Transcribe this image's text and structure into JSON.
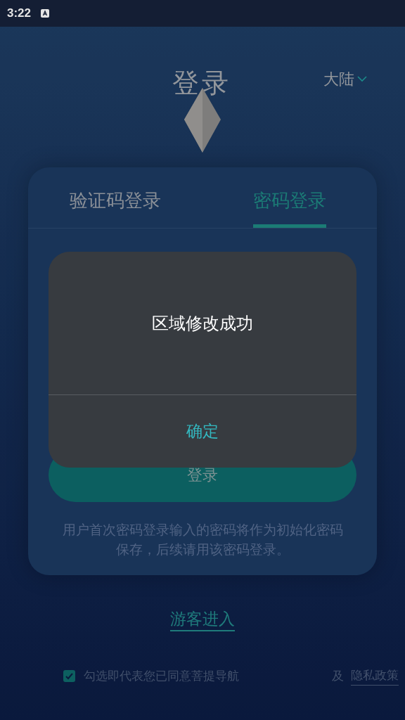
{
  "status_bar": {
    "time": "3:22"
  },
  "header": {
    "title": "登录",
    "region": "大陆"
  },
  "tabs": [
    {
      "label": "验证码登录",
      "selected": false
    },
    {
      "label": "密码登录",
      "selected": true
    }
  ],
  "login_button": "登录",
  "hint": "用户首次密码登录输入的密码将作为初始化密码保存，后续请用该密码登录。",
  "guest_link": "游客进入",
  "agreement": {
    "checked": true,
    "text": "勾选即代表您已同意菩提导航",
    "tail": "及",
    "privacy_link": "隐私政策"
  },
  "dialog": {
    "message": "区域修改成功",
    "button": "确定"
  }
}
